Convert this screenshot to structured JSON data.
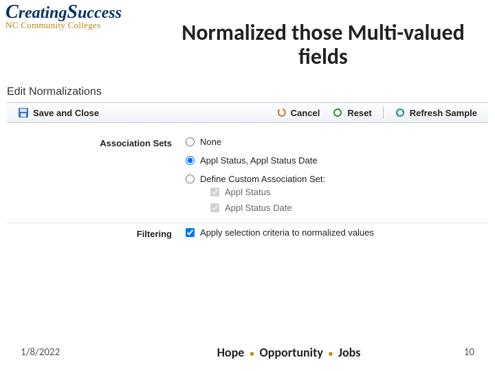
{
  "logo": {
    "line1": "CreatingSuccess",
    "line2": "NC Community Colleges"
  },
  "title": "Normalized those Multi-valued fields",
  "panel": {
    "heading": "Edit Normalizations",
    "toolbar": {
      "save": "Save and Close",
      "cancel": "Cancel",
      "reset": "Reset",
      "refresh": "Refresh Sample"
    },
    "assoc": {
      "label": "Association Sets",
      "opt_none": "None",
      "opt_preset": "Appl Status, Appl Status Date",
      "opt_custom": "Define Custom Association Set:",
      "chk_a": "Appl Status",
      "chk_b": "Appl Status Date"
    },
    "filtering": {
      "label": "Filtering",
      "apply": "Apply selection criteria to normalized values"
    }
  },
  "footer": {
    "date": "1/8/2022",
    "motto_a": "Hope",
    "motto_b": "Opportunity",
    "motto_c": "Jobs",
    "page": "10"
  },
  "colors": {
    "navy": "#003366",
    "gold": "#b8860b",
    "green": "#3a8a3a",
    "teal": "#2a8a88"
  }
}
